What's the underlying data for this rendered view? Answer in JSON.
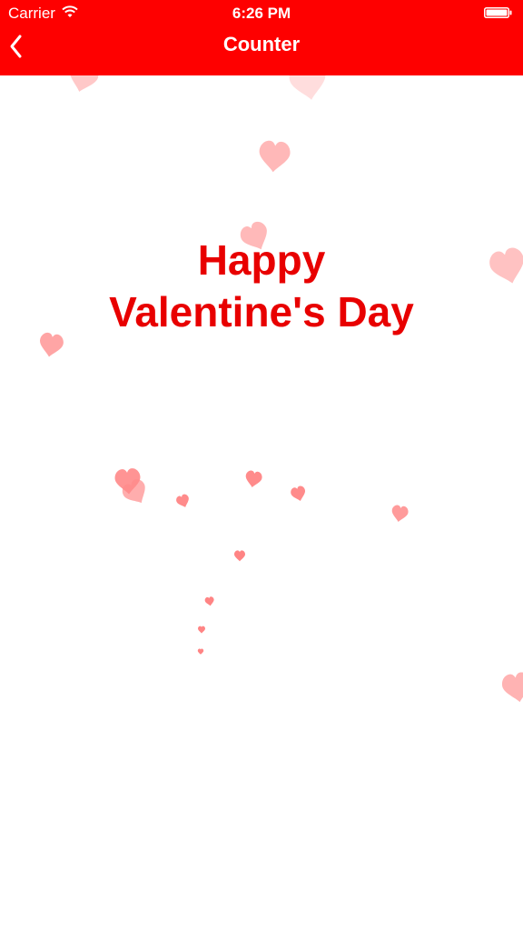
{
  "status_bar": {
    "carrier": "Carrier",
    "time": "6:26 PM",
    "wifi_icon": "wifi-icon",
    "battery_icon": "battery-icon"
  },
  "nav_bar": {
    "title": "Counter",
    "back_icon": "chevron-left-icon"
  },
  "message": {
    "line1": "Happy",
    "line2": "Valentine's Day"
  },
  "decorations": {
    "icon": "heart-icon"
  },
  "colors": {
    "bar_background": "#fe0000",
    "message_text": "#e80000",
    "heart_pink": "#ff8a8a"
  }
}
